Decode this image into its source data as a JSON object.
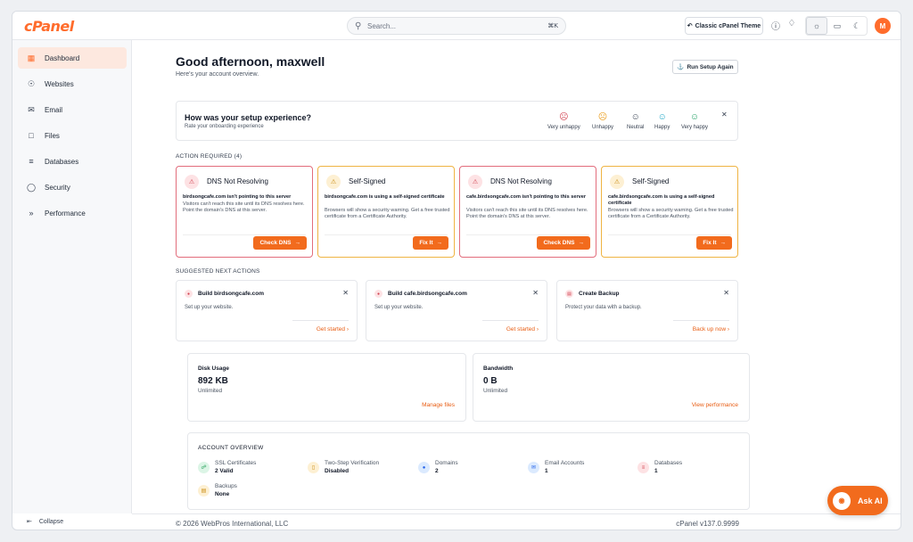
{
  "app": {
    "logo": "cPanel"
  },
  "topbar": {
    "search_placeholder": "Search...",
    "search_shortcut": "⌘K",
    "theme_button": "Classic cPanel Theme",
    "avatar_initial": "M"
  },
  "sidebar": {
    "items": [
      {
        "label": "Dashboard",
        "icon": "grid-icon",
        "active": true
      },
      {
        "label": "Websites",
        "icon": "globe-icon"
      },
      {
        "label": "Email",
        "icon": "mail-icon"
      },
      {
        "label": "Files",
        "icon": "folder-icon"
      },
      {
        "label": "Databases",
        "icon": "database-icon"
      },
      {
        "label": "Security",
        "icon": "shield-icon"
      },
      {
        "label": "Performance",
        "icon": "fast-forward-icon"
      }
    ],
    "collapse": "Collapse"
  },
  "header": {
    "greeting": "Good afternoon, maxwell",
    "subtitle": "Here's your account overview.",
    "setup_button": "Run Setup Again"
  },
  "feedback": {
    "title": "How was your setup experience?",
    "subtitle": "Rate your onboarding experience",
    "options": [
      "Very unhappy",
      "Unhappy",
      "Neutral",
      "Happy",
      "Very happy"
    ]
  },
  "action_required": {
    "label": "ACTION REQUIRED (4)",
    "cards": [
      {
        "title": "DNS Not Resolving",
        "heading": "birdsongcafe.com isn't pointing to this server",
        "body": "Visitors can't reach this site until its DNS resolves here. Point the domain's DNS at this server.",
        "button": "Check DNS"
      },
      {
        "title": "Self-Signed",
        "heading": "birdsongcafe.com is using a self-signed certificate",
        "body": "Browsers will show a security warning. Get a free trusted certificate from a Certificate Authority.",
        "button": "Fix It"
      },
      {
        "title": "DNS Not Resolving",
        "heading": "cafe.birdsongcafe.com isn't pointing to this server",
        "body": "Visitors can't reach this site until its DNS resolves here. Point the domain's DNS at this server.",
        "button": "Check DNS"
      },
      {
        "title": "Self-Signed",
        "heading": "cafe.birdsongcafe.com is using a self-signed certificate",
        "body": "Browsers will show a security warning. Get a free trusted certificate from a Certificate Authority.",
        "button": "Fix It"
      }
    ]
  },
  "suggested": {
    "label": "SUGGESTED NEXT ACTIONS",
    "cards": [
      {
        "title": "Build birdsongcafe.com",
        "desc": "Set up your website.",
        "link": "Get started"
      },
      {
        "title": "Build cafe.birdsongcafe.com",
        "desc": "Set up your website.",
        "link": "Get started"
      },
      {
        "title": "Create Backup",
        "desc": "Protect your data with a backup.",
        "link": "Back up now"
      }
    ]
  },
  "disk": {
    "label": "Disk Usage",
    "value": "892 KB",
    "limit": "Unlimited",
    "link": "Manage files"
  },
  "bandwidth": {
    "label": "Bandwidth",
    "value": "0 B",
    "limit": "Unlimited",
    "link": "View performance"
  },
  "overview": {
    "label": "ACCOUNT OVERVIEW",
    "items": [
      {
        "name": "SSL Certificates",
        "value": "2 Valid"
      },
      {
        "name": "Two-Step Verification",
        "value": "Disabled"
      },
      {
        "name": "Domains",
        "value": "2"
      },
      {
        "name": "Email Accounts",
        "value": "1"
      },
      {
        "name": "Databases",
        "value": "1"
      },
      {
        "name": "Backups",
        "value": "None"
      }
    ]
  },
  "footer": {
    "copyright": "© 2026 WebPros International, LLC",
    "version": "cPanel v137.0.9999"
  },
  "ask_ai": "Ask AI",
  "colors": {
    "accent": "#f26b1d",
    "danger_border": "#e26d7c",
    "warning_border": "#efb443"
  }
}
